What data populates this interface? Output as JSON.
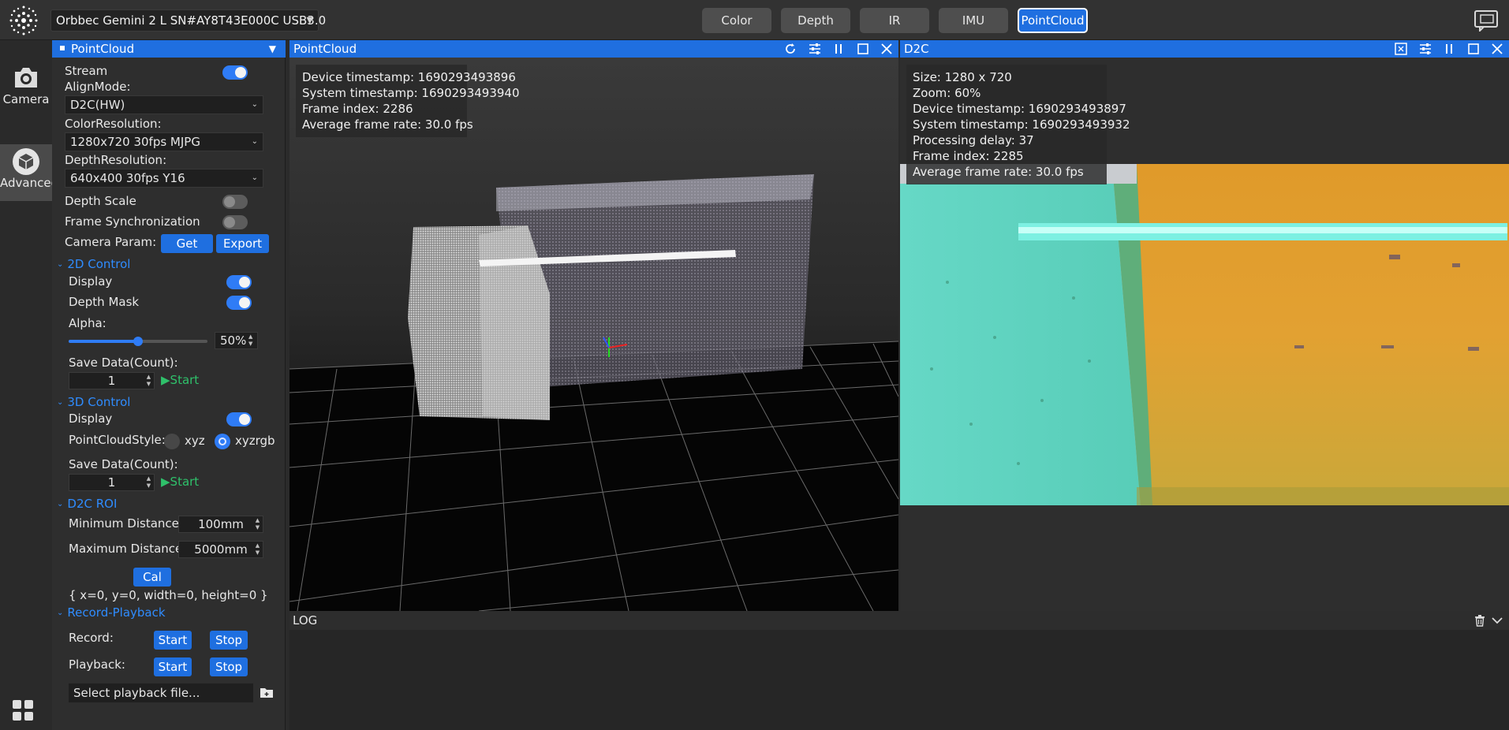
{
  "device": {
    "name": "Orbbec Gemini 2 L SN#AY8T43E000C USB3.0"
  },
  "mode_tabs": [
    {
      "label": "Color",
      "active": false
    },
    {
      "label": "Depth",
      "active": false
    },
    {
      "label": "IR",
      "active": false
    },
    {
      "label": "IMU",
      "active": false
    },
    {
      "label": "PointCloud",
      "active": true
    }
  ],
  "rail": {
    "camera_label": "Camera",
    "advanced_label": "Advanced"
  },
  "panel": {
    "title": "PointCloud",
    "stream_label": "Stream",
    "stream_on": true,
    "align_mode_label": "AlignMode:",
    "align_mode_value": "D2C(HW)",
    "color_res_label": "ColorResolution:",
    "color_res_value": "1280x720 30fps MJPG",
    "depth_res_label": "DepthResolution:",
    "depth_res_value": "640x400 30fps Y16",
    "depth_scale_label": "Depth Scale",
    "depth_scale_on": false,
    "frame_sync_label": "Frame Synchronization",
    "frame_sync_on": false,
    "camera_param_label": "Camera Param:",
    "get_label": "Get",
    "export_label": "Export",
    "control_2d": {
      "title": "2D Control",
      "display_label": "Display",
      "display_on": true,
      "depth_mask_label": "Depth Mask",
      "depth_mask_on": true,
      "alpha_label": "Alpha:",
      "alpha_value": "50%",
      "alpha_fraction": 0.5,
      "save_label": "Save Data(Count):",
      "save_count": "1",
      "start_label": "Start"
    },
    "control_3d": {
      "title": "3D Control",
      "display_label": "Display",
      "display_on": true,
      "style_label": "PointCloudStyle:",
      "style_options": [
        "xyz",
        "xyzrgb"
      ],
      "style_selected": "xyzrgb",
      "save_label": "Save Data(Count):",
      "save_count": "1",
      "start_label": "Start"
    },
    "d2c_roi": {
      "title": "D2C ROI",
      "min_label": "Minimum Distance:",
      "min_value": "100mm",
      "max_label": "Maximum Distance:",
      "max_value": "5000mm",
      "cal_label": "Cal",
      "roi_text": "{ x=0, y=0, width=0, height=0 }"
    },
    "record_playback": {
      "title": "Record-Playback",
      "record_label": "Record:",
      "playback_label": "Playback:",
      "start_label": "Start",
      "stop_label": "Stop",
      "file_placeholder": "Select playback file..."
    }
  },
  "pointcloud_view": {
    "title": "PointCloud",
    "info": [
      "Device timestamp: 1690293493896",
      "System timestamp: 1690293493940",
      "Frame index: 2286",
      "Average frame rate: 30.0 fps"
    ]
  },
  "d2c_view": {
    "title": "D2C",
    "info": [
      "Size: 1280 x 720",
      "Zoom: 60%",
      "Device timestamp: 1690293493897",
      "System timestamp: 1690293493932",
      "Processing delay: 37",
      "Frame index: 2285",
      "Average frame rate: 30.0 fps"
    ]
  },
  "log": {
    "title": "LOG"
  },
  "colors": {
    "accent": "#1f6fe0",
    "start_green": "#2fc06a",
    "section_blue": "#2f8cff"
  }
}
